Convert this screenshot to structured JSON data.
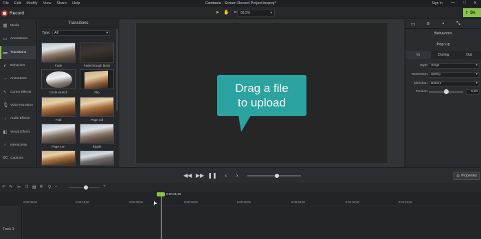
{
  "menubar": {
    "items": [
      "File",
      "Edit",
      "Modify",
      "View",
      "Share",
      "Help"
    ],
    "title": "Camtasia - Screen Record Project.tscproj*",
    "signin": "Sign In",
    "window_controls": [
      "—",
      "□",
      "✕"
    ]
  },
  "toolbar": {
    "record_label": "Record",
    "zoom_value": "68.5%",
    "share_label": "Sh",
    "tool_icons": [
      "arrow-select-icon",
      "hand-pan-icon",
      "crop-icon"
    ]
  },
  "leftnav": {
    "items": [
      {
        "label": "Media",
        "icon": "media-icon"
      },
      {
        "label": "Annotations",
        "icon": "annotations-icon"
      },
      {
        "label": "Transitions",
        "icon": "transitions-icon"
      },
      {
        "label": "Behaviors",
        "icon": "behaviors-icon"
      },
      {
        "label": "Animations",
        "icon": "animations-icon"
      },
      {
        "label": "Cursor Effects",
        "icon": "cursor-effects-icon"
      },
      {
        "label": "Voice Narration",
        "icon": "microphone-icon"
      },
      {
        "label": "Audio Effects",
        "icon": "audio-effects-icon"
      },
      {
        "label": "Visual Effects",
        "icon": "visual-effects-icon"
      },
      {
        "label": "Interactivity",
        "icon": "interactivity-icon"
      },
      {
        "label": "Captions",
        "icon": "captions-icon"
      }
    ],
    "active_index": 2
  },
  "panel": {
    "title": "Transitions",
    "type_label": "Type:",
    "type_value": "All",
    "tiles": [
      {
        "label": "Fade"
      },
      {
        "label": "Fade through black"
      },
      {
        "label": "Circle stretch"
      },
      {
        "label": "Flip"
      },
      {
        "label": "Fold"
      },
      {
        "label": "Page roll"
      },
      {
        "label": "Page turn"
      },
      {
        "label": "Ripple"
      },
      {
        "label": ""
      },
      {
        "label": ""
      }
    ]
  },
  "canvas": {
    "drop_message_line1": "Drag a file",
    "drop_message_line2": "to upload",
    "bubble_color": "#2ba3a0"
  },
  "rightpanel": {
    "title": "Behaviors",
    "effect_name": "Pop Up",
    "tabs": [
      "In",
      "During",
      "Out"
    ],
    "active_tab": 0,
    "props": [
      {
        "label": "Style:",
        "value": "Hinge"
      },
      {
        "label": "Movement:",
        "value": "Spring"
      },
      {
        "label": "Direction:",
        "value": "Bottom"
      }
    ],
    "tension_label": "Tension:",
    "tension_value": "5.00",
    "tension_fraction": 0.5
  },
  "playback": {
    "properties_label": "Properties",
    "progress_fraction": 0.55
  },
  "timeline": {
    "playhead_time": "0:00:21;29",
    "ticks": [
      "0:00:00;00",
      "0:00:10;00",
      "0:00:20;00",
      "0:00:30;00",
      "0:00:40;00",
      "0:00:50;00",
      "0:01:00;00",
      "0:01:10;00"
    ],
    "track_label": "Track 3"
  },
  "colors": {
    "accent": "#8bc34a",
    "record": "#c9352a",
    "background": "#2b2d30"
  }
}
